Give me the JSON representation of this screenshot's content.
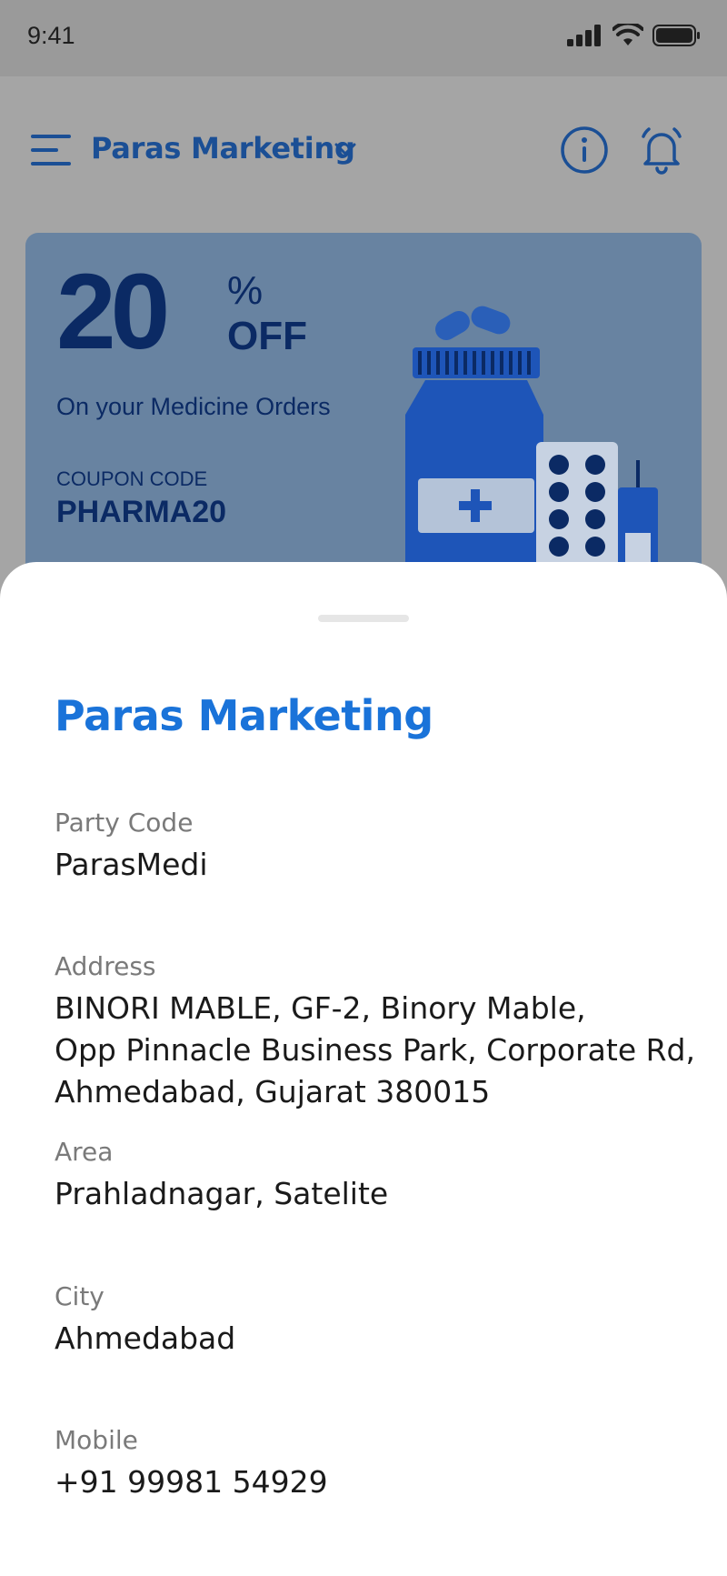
{
  "status_bar": {
    "time": "9:41"
  },
  "header": {
    "store_name": "Paras Marketing"
  },
  "banner": {
    "big_number": "20",
    "percent": "%",
    "off": "OFF",
    "subtitle": "On your Medicine Orders",
    "coupon_label": "COUPON CODE",
    "coupon_code": "PHARMA20",
    "colors": {
      "background": "#6883a1",
      "text": "#0b2a64",
      "accent": "#1b4f95"
    }
  },
  "sheet": {
    "title": "Paras Marketing",
    "fields": [
      {
        "label": "Party Code",
        "value": [
          "ParasMedi"
        ]
      },
      {
        "label": "Address",
        "value": [
          "BINORI MABLE, GF-2, Binory Mable,",
          "Opp Pinnacle Business Park, Corporate Rd,",
          "Ahmedabad, Gujarat 380015"
        ]
      },
      {
        "label": "Area",
        "value": [
          "Prahladnagar, Satelite"
        ]
      },
      {
        "label": "City",
        "value": [
          "Ahmedabad"
        ]
      },
      {
        "label": "Mobile",
        "value": [
          "+91 99981 54929"
        ]
      }
    ]
  },
  "icons": [
    "menu-icon",
    "chevron-down-icon",
    "info-icon",
    "bell-icon",
    "signal-icon",
    "wifi-icon",
    "battery-icon"
  ],
  "colors": {
    "title_blue": "#1a73d9",
    "label_grey": "#7a7a7a",
    "value_black": "#1a1a1a"
  }
}
